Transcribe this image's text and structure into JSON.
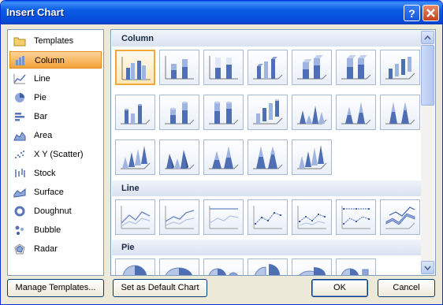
{
  "window": {
    "title": "Insert Chart",
    "help_label": "?",
    "close_label": "✕"
  },
  "categories": [
    {
      "label": "Templates",
      "icon": "folder-icon"
    },
    {
      "label": "Column",
      "icon": "column-chart-icon",
      "selected": true
    },
    {
      "label": "Line",
      "icon": "line-chart-icon"
    },
    {
      "label": "Pie",
      "icon": "pie-chart-icon"
    },
    {
      "label": "Bar",
      "icon": "bar-chart-icon"
    },
    {
      "label": "Area",
      "icon": "area-chart-icon"
    },
    {
      "label": "X Y (Scatter)",
      "icon": "scatter-chart-icon"
    },
    {
      "label": "Stock",
      "icon": "stock-chart-icon"
    },
    {
      "label": "Surface",
      "icon": "surface-chart-icon"
    },
    {
      "label": "Doughnut",
      "icon": "doughnut-chart-icon"
    },
    {
      "label": "Bubble",
      "icon": "bubble-chart-icon"
    },
    {
      "label": "Radar",
      "icon": "radar-chart-icon"
    }
  ],
  "gallery": {
    "sections": [
      {
        "title": "Column"
      },
      {
        "title": "Line"
      },
      {
        "title": "Pie"
      }
    ]
  },
  "buttons": {
    "manage_templates": "Manage Templates...",
    "set_default": "Set as Default Chart",
    "ok": "OK",
    "cancel": "Cancel"
  },
  "colors": {
    "selection": "#f4a13a",
    "title_bar": "#0a5ce4",
    "chart_blue": "#4f6fb5"
  }
}
